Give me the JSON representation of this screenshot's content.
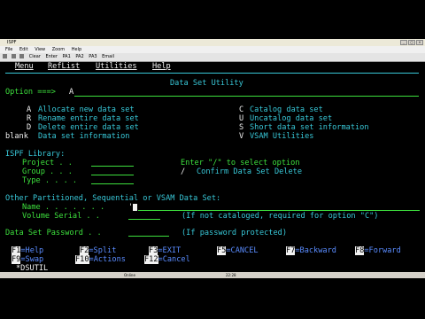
{
  "window": {
    "title": "ISPF",
    "menu": [
      "File",
      "Edit",
      "View",
      "Zoom",
      "Help"
    ],
    "toolbar": [
      "Clear",
      "Enter",
      "PA1",
      "PA2",
      "PA3",
      "Email"
    ]
  },
  "ispf_menu": [
    "Menu",
    "RefList",
    "Utilities",
    "Help"
  ],
  "panel_title": "Data Set Utility",
  "option_label": "Option ===>",
  "option_value": "A",
  "options_left": [
    {
      "key": "A",
      "text": "Allocate new data set"
    },
    {
      "key": "R",
      "text": "Rename entire data set"
    },
    {
      "key": "D",
      "text": "Delete entire data set"
    },
    {
      "key": "blank",
      "text": "Data set information"
    }
  ],
  "options_right": [
    {
      "key": "C",
      "text": "Catalog data set"
    },
    {
      "key": "U",
      "text": "Uncatalog data set"
    },
    {
      "key": "S",
      "text": "Short data set information"
    },
    {
      "key": "V",
      "text": "VSAM Utilities"
    }
  ],
  "library": {
    "heading": "ISPF Library:",
    "project": "Project . .",
    "group": "Group . . .",
    "type": "Type . . . ."
  },
  "confirm": {
    "prompt": "Enter \"/\" to select option",
    "mark": "/",
    "text": "Confirm Data Set Delete"
  },
  "other": {
    "heading": "Other Partitioned, Sequential or VSAM Data Set:",
    "name_label": "Name . . . . . . .",
    "name_value": "'",
    "volume_label": "Volume Serial . .",
    "volume_note": "(If not cataloged, required for option \"C\")"
  },
  "password": {
    "label": "Data Set Password . .",
    "note": "(If password protected)"
  },
  "pf_keys": [
    {
      "key": "F1",
      "label": "=Help"
    },
    {
      "key": "F2",
      "label": "=Split"
    },
    {
      "key": "F3",
      "label": "=EXIT"
    },
    {
      "key": "F5",
      "label": "=CANCEL"
    },
    {
      "key": "F7",
      "label": "=Backward"
    },
    {
      "key": "F8",
      "label": "=Forward"
    },
    {
      "key": "F9",
      "label": "=Swap"
    },
    {
      "key": "F10",
      "label": "=Actions"
    },
    {
      "key": "F12",
      "label": "=Cancel"
    }
  ],
  "screen_id": "*DSUTIL",
  "status": {
    "left": "Online",
    "right": "22:28"
  }
}
